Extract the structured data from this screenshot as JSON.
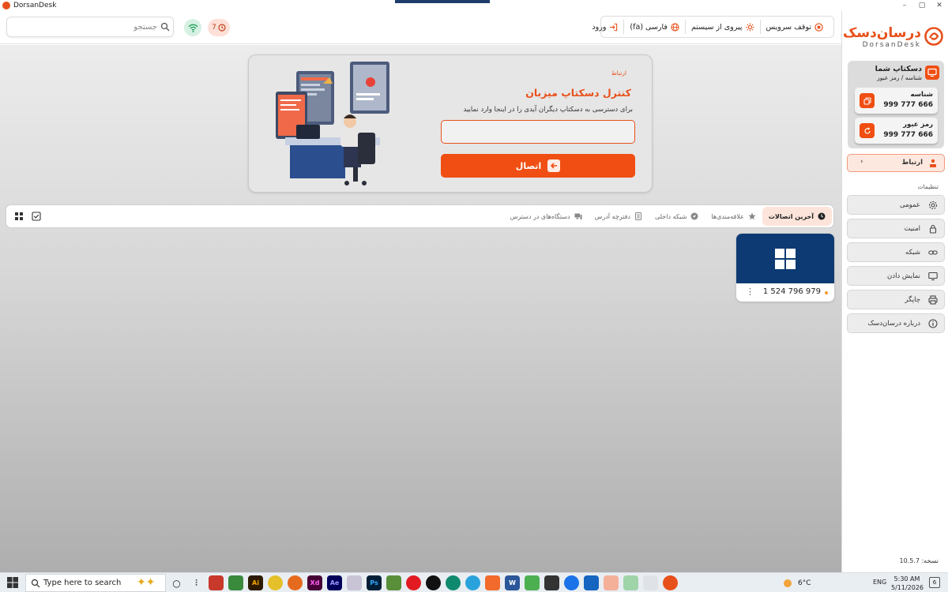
{
  "window": {
    "title": "DorsanDesk",
    "controls": [
      "–",
      "▢",
      "✕"
    ]
  },
  "topbar": {
    "search_placeholder": "جستجو",
    "notification_count": "7",
    "actions": {
      "stop_service": "توقف سرویس",
      "follow_system": "پیروی از سیستم",
      "language": "فارسی (fa)",
      "login": "ورود"
    }
  },
  "hero": {
    "crumb": "ارتباط",
    "title": "کنترل دسکتاپ میزبان",
    "description": "برای دسترسی به دسکتاپ دیگران آیدی را در اینجا وارد نمایید",
    "id_input_value": "",
    "connect_label": "اتصال"
  },
  "tabs": {
    "items": [
      {
        "label": "آخرین اتصالات",
        "active": true,
        "icon": "clock-icon"
      },
      {
        "label": "علاقه‌مندی‌ها",
        "active": false,
        "icon": "star-icon"
      },
      {
        "label": "شبکه داخلی",
        "active": false,
        "icon": "compass-icon"
      },
      {
        "label": "دفترچه آدرس",
        "active": false,
        "icon": "address-book-icon"
      },
      {
        "label": "دستگاه‌های در دسترس",
        "active": false,
        "icon": "devices-icon"
      }
    ]
  },
  "device": {
    "id": "1 524 796 979",
    "os": "windows-logo-icon",
    "status_color": "#f39a2e"
  },
  "sidebar": {
    "brand_name": "درسان‌دسک",
    "brand_sub": "DorsanDesk",
    "my_desktop": {
      "title": "دسکتاپ شما",
      "subtitle": "شناسه / رمز عبور",
      "id_label": "شناسه",
      "id_value": "999 777 666",
      "password_label": "رمز عبور",
      "password_value": "999 777 666"
    },
    "connect_nav": "ارتباط",
    "settings_heading": "تنظیمات",
    "settings": [
      {
        "label": "عمومی",
        "icon": "gear-icon"
      },
      {
        "label": "امنیت",
        "icon": "lock-icon"
      },
      {
        "label": "شبکه",
        "icon": "link-icon"
      },
      {
        "label": "نمایش دادن",
        "icon": "monitor-icon"
      },
      {
        "label": "چاپگر",
        "icon": "printer-icon"
      },
      {
        "label": "درباره درسان‌دسک",
        "icon": "info-icon"
      }
    ],
    "version": "نسخه: 10.5.7"
  },
  "taskbar": {
    "search_placeholder": "Type here to search",
    "weather": "6°C",
    "language": "ENG",
    "time": "5:30 AM",
    "date": "5/11/2026",
    "notification_count": "6"
  },
  "colors": {
    "accent": "#f04e12",
    "brand": "#e8501b",
    "device_card": "#0d3a72"
  }
}
